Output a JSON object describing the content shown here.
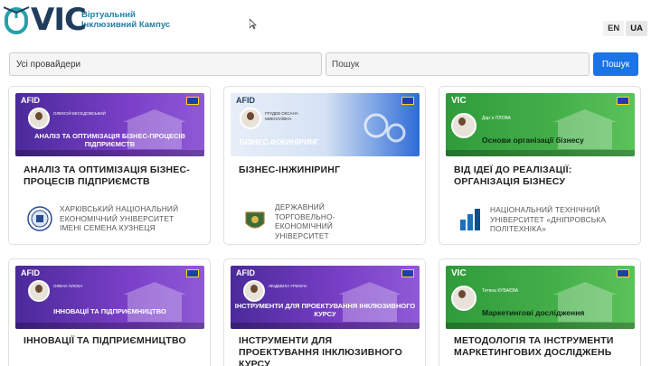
{
  "header": {
    "logo_text": "VIC",
    "logo_subtitle_line1": "Віртуальний",
    "logo_subtitle_line2": "Інклюзивний Кампус",
    "lang_en": "EN",
    "lang_ua": "UA"
  },
  "search": {
    "provider_value": "Усі провайдери",
    "placeholder": "Пошук",
    "button_label": "Пошук"
  },
  "courses": [
    {
      "title": "АНАЛІЗ ТА ОПТИМІЗАЦІЯ БІЗНЕС-ПРОЦЕСІВ ПІДПРИЄМСТВ",
      "banner_logo": "AFID",
      "banner_title": "АНАЛІЗ ТА ОПТИМІЗАЦІЯ БІЗНЕС-ПРОЦЕСІВ ПІДПРИЄМСТВ",
      "banner_person": "ОЛЕКСІЙ БЕСЕДОВСЬКИЙ",
      "provider": "ХАРКІВСЬКИЙ НАЦІОНАЛЬНИЙ ЕКОНОМІЧНИЙ УНІВЕРСИТЕТ ІМЕНІ СЕМЕНА КУЗНЕЦЯ"
    },
    {
      "title": "БІЗНЕС-ІНЖИНІРИНГ",
      "banner_logo": "AFID",
      "banner_title": "БІЗНЕС-ІНЖИНІРИНГ",
      "banner_person": "ГРУДЕВ ОКСАНА МИКОЛАЇВНА",
      "provider": "ДЕРЖАВНИЙ ТОРГОВЕЛЬНО-ЕКОНОМІЧНИЙ УНІВЕРСИТЕТ"
    },
    {
      "title": "ВІД ІДЕЇ ДО РЕАЛІЗАЦІЇ: ОРГАНІЗАЦІЯ БІЗНЕСУ",
      "banner_logo": "VIC",
      "banner_title": "Основи організації бізнесу",
      "banner_person": "Дар`я ПЛОВА",
      "provider": "НАЦІОНАЛЬНИЙ ТЕХНІЧНИЙ УНІВЕРСИТЕТ «ДНІПРОВСЬКА ПОЛІТЕХНІКА»"
    },
    {
      "title": "ІННОВАЦІЇ ТА ПІДПРИЄМНИЦТВО",
      "banner_logo": "AFID",
      "banner_title": "ІННОВАЦІЇ ТА ПІДПРИЄМНИЦТВО",
      "banner_person": "ОЛЕНА ПЛОХА"
    },
    {
      "title": "ІНСТРУМЕНТИ ДЛЯ ПРОЕКТУВАННЯ ІНКЛЮЗИВНОГО КУРСУ",
      "banner_logo": "AFID",
      "banner_title": "ІНСТРУМЕНТИ ДЛЯ ПРОЕКТУВАННЯ ІНКЛЮЗИВНОГО КУРСУ",
      "banner_person": "ЛЮДМИЛА ГРИЗУН"
    },
    {
      "title": "МЕТОДОЛОГІЯ ТА ІНСТРУМЕНТИ МАРКЕТИНГОВИХ ДОСЛІДЖЕНЬ",
      "banner_logo": "VIC",
      "banner_title": "Маркетингові дослідження",
      "banner_person": "Тетяна КУБАЄВА"
    }
  ],
  "colors": {
    "accent": "#1b73e8",
    "banner_purple": "#7b3fc8",
    "banner_green": "#45b04a"
  }
}
